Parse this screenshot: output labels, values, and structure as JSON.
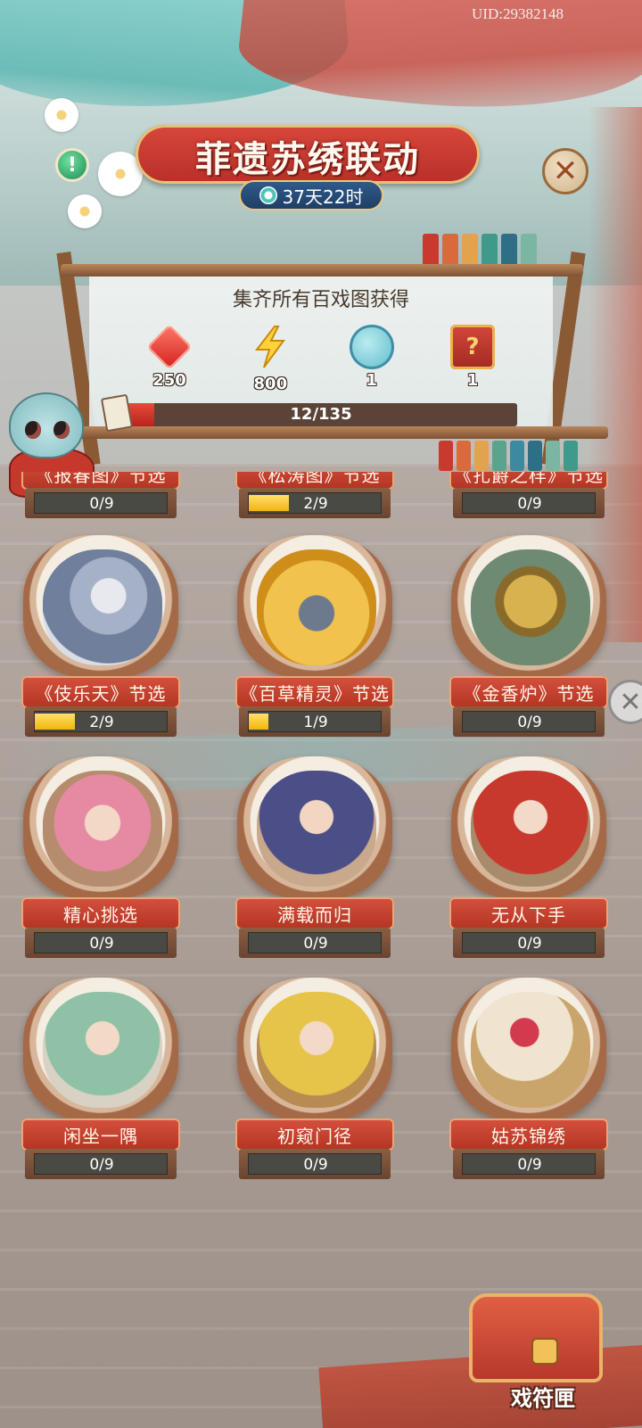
{
  "header": {
    "uid": "UID:29382148",
    "title": "菲遗苏绣联动",
    "timer": "37天22时",
    "info_icon": "info-exclamation-icon",
    "close_icon": "close-x-icon"
  },
  "reward_panel": {
    "title": "集齐所有百戏图获得",
    "rewards": [
      {
        "icon": "red-gem-icon",
        "count": "250"
      },
      {
        "icon": "lightning-bolt-icon",
        "count": "800"
      },
      {
        "icon": "lucky-bag-icon",
        "count": "1"
      },
      {
        "icon": "mystery-chest-icon",
        "count": "1"
      }
    ],
    "progress_text": "12/135",
    "progress_current": 12,
    "progress_total": 135
  },
  "cards": [
    {
      "label": "《报春图》节选",
      "progress": "0/9",
      "fraction": 0,
      "art": "art-pink",
      "partial": true
    },
    {
      "label": "《松涛图》节选",
      "progress": "2/9",
      "fraction": 0.2222,
      "art": "art-green",
      "partial": true
    },
    {
      "label": "《扎爵之样》节选",
      "progress": "0/9",
      "fraction": 0,
      "art": "art-censer",
      "partial": true
    },
    {
      "label": "《伎乐天》节选",
      "progress": "2/9",
      "fraction": 0.2222,
      "art": "art-dancer"
    },
    {
      "label": "《百草精灵》节选",
      "progress": "1/9",
      "fraction": 0.1111,
      "art": "art-monkey"
    },
    {
      "label": "《金香炉》节选",
      "progress": "0/9",
      "fraction": 0,
      "art": "art-censer"
    },
    {
      "label": "精心挑选",
      "progress": "0/9",
      "fraction": 0,
      "art": "art-pink"
    },
    {
      "label": "满载而归",
      "progress": "0/9",
      "fraction": 0,
      "art": "art-blue"
    },
    {
      "label": "无从下手",
      "progress": "0/9",
      "fraction": 0,
      "art": "art-red"
    },
    {
      "label": "闲坐一隅",
      "progress": "0/9",
      "fraction": 0,
      "art": "art-green"
    },
    {
      "label": "初窥门径",
      "progress": "0/9",
      "fraction": 0,
      "art": "art-yellow"
    },
    {
      "label": "姑苏锦绣",
      "progress": "0/9",
      "fraction": 0,
      "art": "art-peony"
    }
  ],
  "chest_button": {
    "label": "戏符匣",
    "icon": "treasure-chest-icon"
  },
  "colors": {
    "accent_red": "#c63b2f",
    "progress_yellow": "#f1b40f",
    "frame_wood": "#8a5a35"
  }
}
